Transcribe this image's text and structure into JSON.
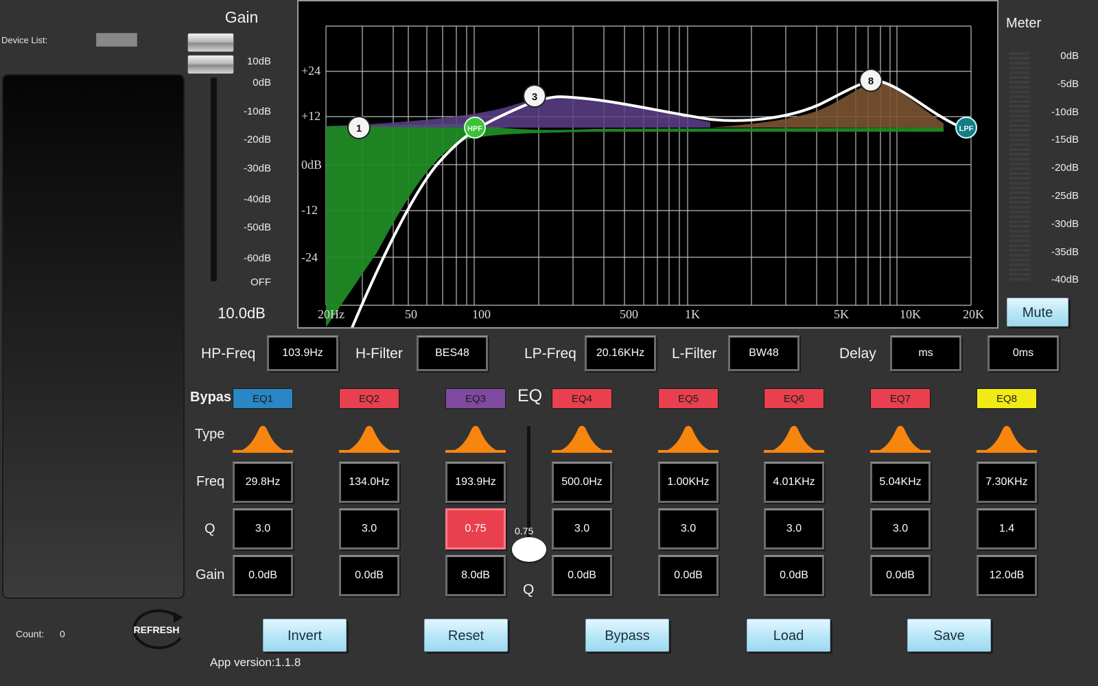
{
  "device_list": {
    "label": "Device List:",
    "count_label": "Count:",
    "count_value": "0",
    "refresh_label": "REFRESH"
  },
  "app_version": "App version:1.1.8",
  "gain": {
    "title": "Gain",
    "ticks": [
      "10dB",
      "0dB",
      "-10dB",
      "-20dB",
      "-30dB",
      "-40dB",
      "-50dB",
      "-60dB",
      "OFF"
    ],
    "value": "10.0dB",
    "fader_level": 1.0
  },
  "graph": {
    "y_labels": [
      "+24",
      "+12",
      "0dB",
      "-12",
      "-24"
    ],
    "x_labels": [
      "20Hz",
      "50",
      "100",
      "500",
      "1K",
      "5K",
      "10K",
      "20K"
    ],
    "markers": [
      "1",
      "3",
      "8",
      "HPF",
      "LPF"
    ],
    "colors": {
      "curve": "#ffffff",
      "hpf_fill": "#1f8a25",
      "eq3_fill": "#5d3f8a",
      "eq8_fill": "#7a5332",
      "hpf_marker": "#3cc23a",
      "lpf_marker": "#1a7b82"
    }
  },
  "meter": {
    "title": "Meter",
    "ticks": [
      "0dB",
      "-5dB",
      "-10dB",
      "-15dB",
      "-20dB",
      "-25dB",
      "-30dB",
      "-35dB",
      "-40dB"
    ],
    "mute_label": "Mute"
  },
  "filters": {
    "hp_freq_label": "HP-Freq",
    "hp_freq_value": "103.9Hz",
    "h_filter_label": "H-Filter",
    "h_filter_value": "BES48",
    "lp_freq_label": "LP-Freq",
    "lp_freq_value": "20.16KHz",
    "l_filter_label": "L-Filter",
    "l_filter_value": "BW48",
    "delay_label": "Delay",
    "delay_unit": "ms",
    "delay_value": "0ms"
  },
  "eq": {
    "bypass_label": "Bypas",
    "type_label": "Type",
    "freq_label": "Freq",
    "q_label": "Q",
    "gain_label": "Gain",
    "eq_title": "EQ",
    "q_title": "Q",
    "q_slider_value": "0.75",
    "bands": [
      {
        "name": "EQ1",
        "color": "#2a86c4",
        "freq": "29.8Hz",
        "q": "3.0",
        "gain": "0.0dB",
        "selected": false
      },
      {
        "name": "EQ2",
        "color": "#e8404f",
        "freq": "134.0Hz",
        "q": "3.0",
        "gain": "0.0dB",
        "selected": false
      },
      {
        "name": "EQ3",
        "color": "#7f4aa0",
        "freq": "193.9Hz",
        "q": "0.75",
        "gain": "8.0dB",
        "selected": true
      },
      {
        "name": "EQ4",
        "color": "#e8404f",
        "freq": "500.0Hz",
        "q": "3.0",
        "gain": "0.0dB",
        "selected": false
      },
      {
        "name": "EQ5",
        "color": "#e8404f",
        "freq": "1.00KHz",
        "q": "3.0",
        "gain": "0.0dB",
        "selected": false
      },
      {
        "name": "EQ6",
        "color": "#e8404f",
        "freq": "4.01KHz",
        "q": "3.0",
        "gain": "0.0dB",
        "selected": false
      },
      {
        "name": "EQ7",
        "color": "#e8404f",
        "freq": "5.04KHz",
        "q": "3.0",
        "gain": "0.0dB",
        "selected": false
      },
      {
        "name": "EQ8",
        "color": "#f2ea14",
        "freq": "7.30KHz",
        "q": "1.4",
        "gain": "12.0dB",
        "selected": false
      }
    ]
  },
  "actions": [
    "Invert",
    "Reset",
    "Bypass",
    "Load",
    "Save"
  ]
}
